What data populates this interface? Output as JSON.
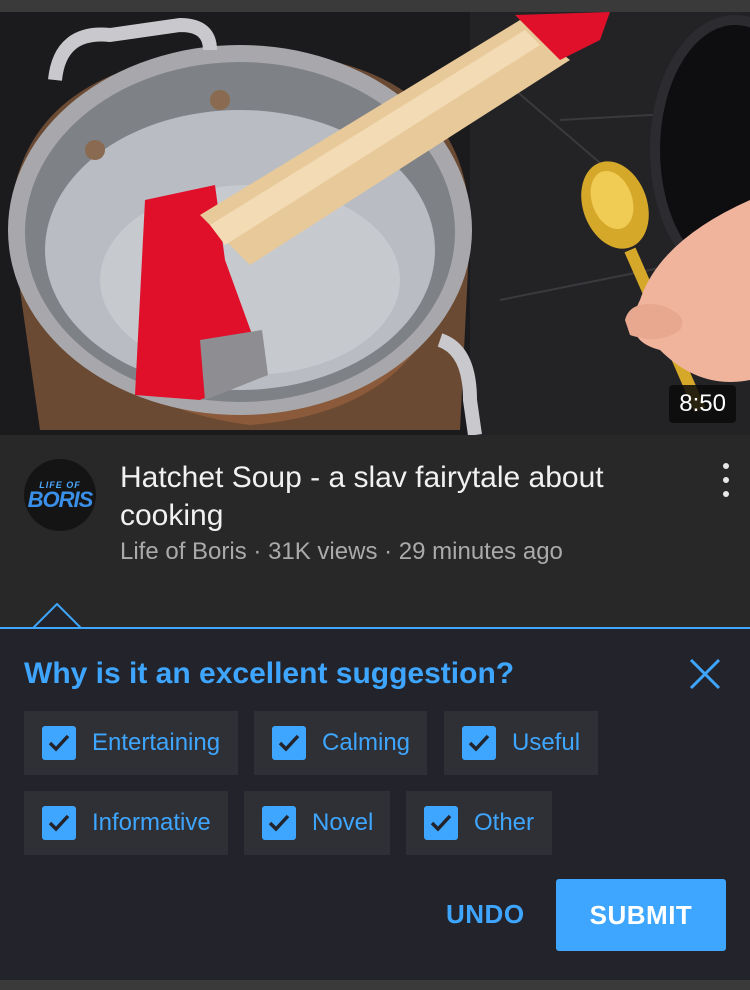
{
  "video": {
    "duration": "8:50",
    "title": "Hatchet Soup - a slav fairytale about cooking",
    "channel": "Life of Boris",
    "views": "31K views",
    "age": "29 minutes ago",
    "separator": " · ",
    "avatar_top": "LIFE OF",
    "avatar_main": "BORIS"
  },
  "feedback": {
    "question": "Why is it an excellent suggestion?",
    "options": [
      {
        "label": "Entertaining",
        "checked": true
      },
      {
        "label": "Calming",
        "checked": true
      },
      {
        "label": "Useful",
        "checked": true
      },
      {
        "label": "Informative",
        "checked": true
      },
      {
        "label": "Novel",
        "checked": true
      },
      {
        "label": "Other",
        "checked": true
      }
    ],
    "undo_label": "UNDO",
    "submit_label": "SUBMIT"
  },
  "icons": {
    "close": "close-icon",
    "more": "more-vert-icon",
    "check": "check-icon"
  },
  "colors": {
    "accent": "#3ea6ff",
    "panel_bg": "#23242b",
    "chip_bg": "#2f3035",
    "page_bg": "#282828"
  }
}
